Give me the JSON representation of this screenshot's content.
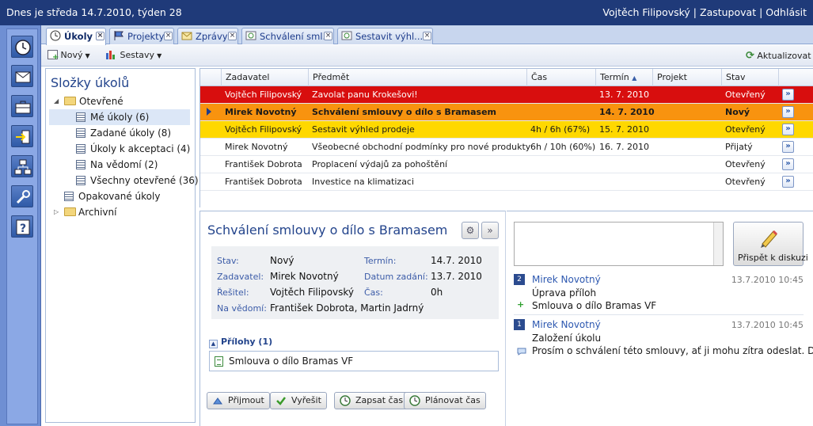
{
  "topbar": {
    "date_text": "Dnes je středa 14.7.2010, týden 28",
    "user": "Vojtěch Filipovský",
    "sep1": " | ",
    "substitute": "Zastupovat",
    "sep2": " | ",
    "logout": "Odhlásit"
  },
  "sidebar_icons": [
    "clock-icon",
    "mail-icon",
    "briefcase-icon",
    "import-icon",
    "network-icon",
    "tools-icon",
    "help-icon"
  ],
  "tabs": [
    {
      "label": "Úkoly",
      "icon": "clock-icon",
      "active": true
    },
    {
      "label": "Projekty",
      "icon": "flag-icon",
      "active": false
    },
    {
      "label": "Zprávy",
      "icon": "envelope-icon",
      "active": false
    },
    {
      "label": "Schválení sml...",
      "icon": "task-icon",
      "active": false
    },
    {
      "label": "Sestavit výhl...",
      "icon": "task-icon",
      "active": false
    }
  ],
  "toolbar": {
    "new_label": "Nový",
    "reports_label": "Sestavy",
    "refresh_label": "Aktualizovat"
  },
  "tree": {
    "title": "Složky úkolů",
    "open": "Otevřené",
    "items": [
      "Mé úkoly (6)",
      "Zadané úkoly (8)",
      "Úkoly k akceptaci (4)",
      "Na vědomí (2)",
      "Všechny otevřené (36)"
    ],
    "recurring": "Opakované úkoly",
    "archive": "Archivní"
  },
  "grid": {
    "columns": {
      "assigner": "Zadavatel",
      "subject": "Předmět",
      "time": "Čas",
      "due": "Termín",
      "project": "Projekt",
      "state": "Stav"
    },
    "rows": [
      {
        "assigner": "Vojtěch Filipovský",
        "subject": "Zavolat panu Krokešovi!",
        "time": "",
        "due": "13. 7. 2010",
        "project": "",
        "state": "Otevřený",
        "style": "red"
      },
      {
        "assigner": "Mirek Novotný",
        "subject": "Schválení smlouvy o dílo s Bramasem",
        "time": "",
        "due": "14. 7. 2010",
        "project": "",
        "state": "Nový",
        "style": "orange"
      },
      {
        "assigner": "Vojtěch Filipovský",
        "subject": "Sestavit výhled prodeje",
        "time": "4h / 6h (67%)",
        "due": "15. 7. 2010",
        "project": "",
        "state": "Otevřený",
        "style": "yellow"
      },
      {
        "assigner": "Mirek Novotný",
        "subject": "Všeobecné obchodní podmínky pro nové produkty",
        "time": "6h / 10h (60%)",
        "due": "16. 7. 2010",
        "project": "",
        "state": "Přijatý",
        "style": "white"
      },
      {
        "assigner": "František Dobrota",
        "subject": "Proplacení výdajů za pohoštění",
        "time": "",
        "due": "",
        "project": "",
        "state": "Otevřený",
        "style": "white"
      },
      {
        "assigner": "František Dobrota",
        "subject": "Investice na klimatizaci",
        "time": "",
        "due": "",
        "project": "",
        "state": "Otevřený",
        "style": "white"
      }
    ]
  },
  "detail": {
    "title": "Schválení smlouvy o dílo s Bramasem",
    "labels": {
      "state": "Stav:",
      "assigner": "Zadavatel:",
      "solver": "Řešitel:",
      "informed": "Na vědomí:",
      "due": "Termín:",
      "assigned_date": "Datum zadání:",
      "time": "Čas:"
    },
    "values": {
      "state": "Nový",
      "assigner": "Mirek Novotný",
      "solver": "Vojtěch Filipovský",
      "informed": "František Dobrota, Martin Jadrný",
      "due": "14.7. 2010",
      "assigned_date": "13.7. 2010",
      "time": "0h"
    },
    "attachments_header": "Přílohy (1)",
    "attachment": "Smlouva o dílo Bramas VF",
    "buttons": {
      "accept": "Přijmout",
      "resolve": "Vyřešit",
      "log_time": "Zapsat čas",
      "plan_time": "Plánovat čas"
    }
  },
  "discussion": {
    "post_label": "Přispět k diskuzi",
    "entries": [
      {
        "num": "2",
        "author": "Mirek Novotný",
        "date": "13.7.2010 10:45",
        "line1": "Úprava příloh",
        "line2": "Smlouva o dílo Bramas VF"
      },
      {
        "num": "1",
        "author": "Mirek Novotný",
        "date": "13.7.2010 10:45",
        "line1": "Založení úkolu",
        "line2": "Prosím o schválení této smlouvy, ať ji mohu zítra odeslat. Díky."
      }
    ]
  }
}
